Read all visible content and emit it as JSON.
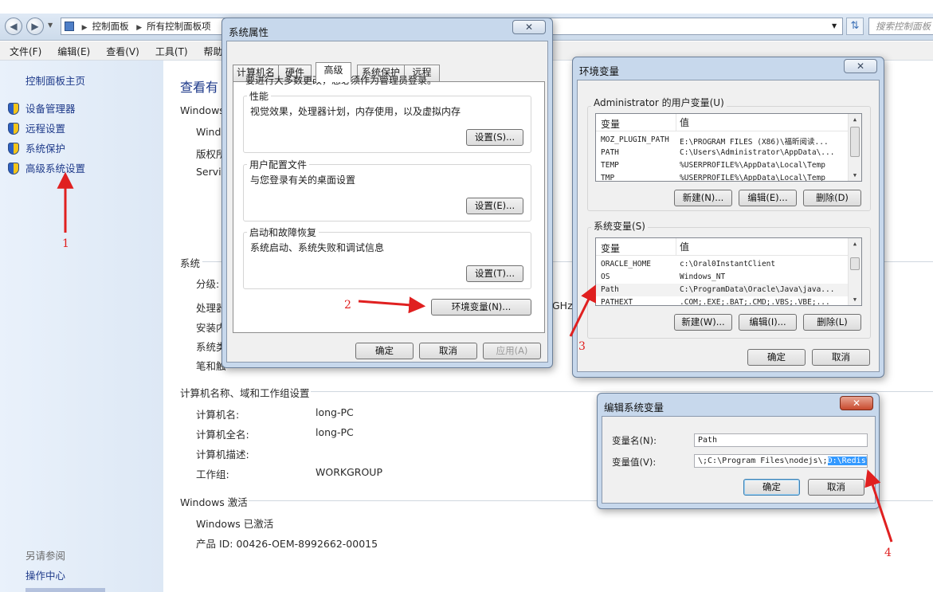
{
  "explorer": {
    "breadcrumb": [
      "控制面板",
      "所有控制面板项"
    ],
    "search_placeholder": "搜索控制面板",
    "menu": [
      "文件(F)",
      "编辑(E)",
      "查看(V)",
      "工具(T)",
      "帮助(H)"
    ],
    "left_pane": {
      "home": "控制面板主页",
      "items": [
        "设备管理器",
        "远程设置",
        "系统保护",
        "高级系统设置"
      ],
      "see_also": "另请参阅",
      "action_center": "操作中心"
    },
    "main": {
      "title": "查看有",
      "windows_label": "Windows",
      "win_lines": [
        "Wind",
        "版权所",
        "Servi"
      ],
      "system_label": "系统",
      "system_lines": [
        "分级:",
        "处理器",
        "安装内",
        "系统类",
        "笔和触"
      ],
      "ghz": "GHz",
      "computer_header": "计算机名称、域和工作组设置",
      "computer_rows": [
        {
          "label": "计算机名:",
          "value": "long-PC"
        },
        {
          "label": "计算机全名:",
          "value": "long-PC"
        },
        {
          "label": "计算机描述:",
          "value": ""
        },
        {
          "label": "工作组:",
          "value": "WORKGROUP"
        }
      ],
      "activation_header": "Windows 激活",
      "activation_status": "Windows 已激活",
      "product_id": "产品 ID: 00426-OEM-8992662-00015"
    }
  },
  "sysprops": {
    "title": "系统属性",
    "tabs": [
      "计算机名",
      "硬件",
      "高级",
      "系统保护",
      "远程"
    ],
    "active_tab": "高级",
    "admin_note": "要进行大多数更改，您必须作为管理员登录。",
    "perf_label": "性能",
    "perf_desc": "视觉效果，处理器计划，内存使用，以及虚拟内存",
    "perf_btn": "设置(S)...",
    "profile_label": "用户配置文件",
    "profile_desc": "与您登录有关的桌面设置",
    "profile_btn": "设置(E)...",
    "startup_label": "启动和故障恢复",
    "startup_desc": "系统启动、系统失败和调试信息",
    "startup_btn": "设置(T)...",
    "env_btn": "环境变量(N)...",
    "ok": "确定",
    "cancel": "取消",
    "apply": "应用(A)"
  },
  "envvars": {
    "title": "环境变量",
    "user_group": "Administrator 的用户变量(U)",
    "col_var": "变量",
    "col_val": "值",
    "user_vars": [
      {
        "name": "MOZ_PLUGIN_PATH",
        "value": "E:\\PROGRAM FILES (X86)\\福昕阅读..."
      },
      {
        "name": "PATH",
        "value": "C:\\Users\\Administrator\\AppData\\..."
      },
      {
        "name": "TEMP",
        "value": "%USERPROFILE%\\AppData\\Local\\Temp"
      },
      {
        "name": "TMP",
        "value": "%USERPROFILE%\\AppData\\Local\\Temp"
      }
    ],
    "sys_group": "系统变量(S)",
    "sys_vars": [
      {
        "name": "ORACLE_HOME",
        "value": "c:\\Oral0InstantClient"
      },
      {
        "name": "OS",
        "value": "Windows_NT"
      },
      {
        "name": "Path",
        "value": "C:\\ProgramData\\Oracle\\Java\\java..."
      },
      {
        "name": "PATHEXT",
        "value": ".COM;.EXE;.BAT;.CMD;.VBS;.VBE;..."
      }
    ],
    "new_user": "新建(N)...",
    "edit_user": "编辑(E)...",
    "delete_user": "删除(D)",
    "new_sys": "新建(W)...",
    "edit_sys": "编辑(I)...",
    "delete_sys": "删除(L)",
    "ok": "确定",
    "cancel": "取消"
  },
  "editvar": {
    "title": "编辑系统变量",
    "name_label": "变量名(N):",
    "name_value": "Path",
    "value_label": "变量值(V):",
    "value_prefix": "\\;C:\\Program Files\\nodejs\\;",
    "value_selected": "D:\\Redis\\",
    "ok": "确定",
    "cancel": "取消"
  },
  "annotations": [
    "1",
    "2",
    "3",
    "4"
  ],
  "colors": {
    "arrow": "#e02020",
    "link": "#1e3a8a",
    "selection": "#3399ff"
  }
}
